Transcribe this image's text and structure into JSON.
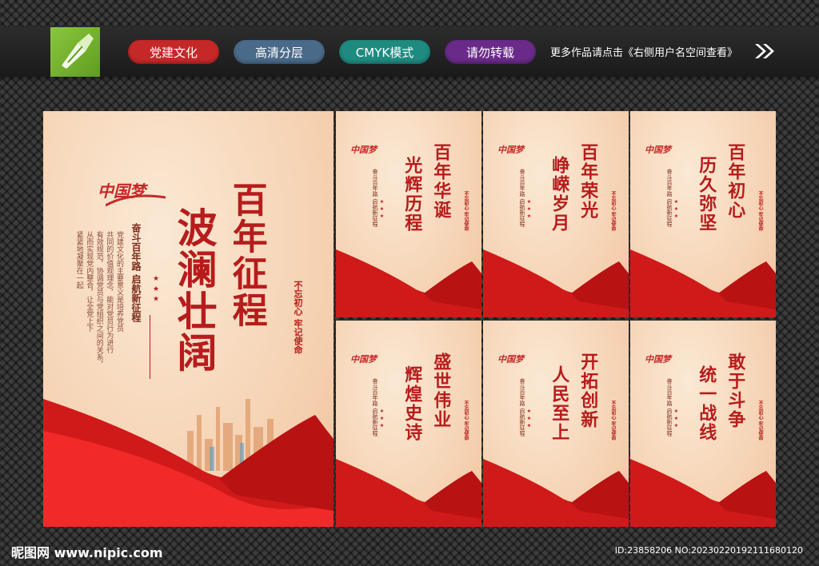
{
  "header": {
    "buttons": [
      {
        "label": "党建文化",
        "color": "#c62828"
      },
      {
        "label": "高清分层",
        "color": "#4a6a8a"
      },
      {
        "label": "CMYK模式",
        "color": "#1f8a80"
      },
      {
        "label": "请勿转载",
        "color": "#6a2a8a"
      }
    ],
    "more_text": "更多作品请点击《右侧用户名空间查看》"
  },
  "main_poster": {
    "brand": "中国梦",
    "title_1": "百年征程",
    "title_2": "波澜壮阔",
    "subtitle": "奋斗百年路 启航新征程",
    "stamp": "不忘初心 牢记使命",
    "body_lines": [
      "党建文化的主要意义是培养党员",
      "共同的价值观理念，能对党员行为进行",
      "有效规范，协调党员与党组织之间的关系，",
      "从而实现党内整合，让全党上下",
      "紧紧地凝聚在一起"
    ]
  },
  "small_posters": [
    {
      "line_1": "百年华诞",
      "line_2": "光辉历程",
      "brand": "中国梦",
      "subtitle": "奋斗百年路 启航新征程",
      "stamp": "不忘初心 牢记使命"
    },
    {
      "line_1": "百年荣光",
      "line_2": "峥嵘岁月",
      "brand": "中国梦",
      "subtitle": "奋斗百年路 启航新征程",
      "stamp": "不忘初心 牢记使命"
    },
    {
      "line_1": "百年初心",
      "line_2": "历久弥坚",
      "brand": "中国梦",
      "subtitle": "奋斗百年路 启航新征程",
      "stamp": "不忘初心 牢记使命"
    },
    {
      "line_1": "盛世伟业",
      "line_2": "辉煌史诗",
      "brand": "中国梦",
      "subtitle": "奋斗百年路 启航新征程",
      "stamp": "不忘初心 牢记使命"
    },
    {
      "line_1": "开拓创新",
      "line_2": "人民至上",
      "brand": "中国梦",
      "subtitle": "奋斗百年路 启航新征程",
      "stamp": "不忘初心 牢记使命"
    },
    {
      "line_1": "敢于斗争",
      "line_2": "统一战线",
      "brand": "中国梦",
      "subtitle": "奋斗百年路 启航新征程",
      "stamp": "不忘初心 牢记使命"
    }
  ],
  "stars": "★ ★ ★",
  "footer": {
    "site": "昵图网 www.nipic.com",
    "id_text": "ID:23858206 NO:20230220192111680120"
  }
}
